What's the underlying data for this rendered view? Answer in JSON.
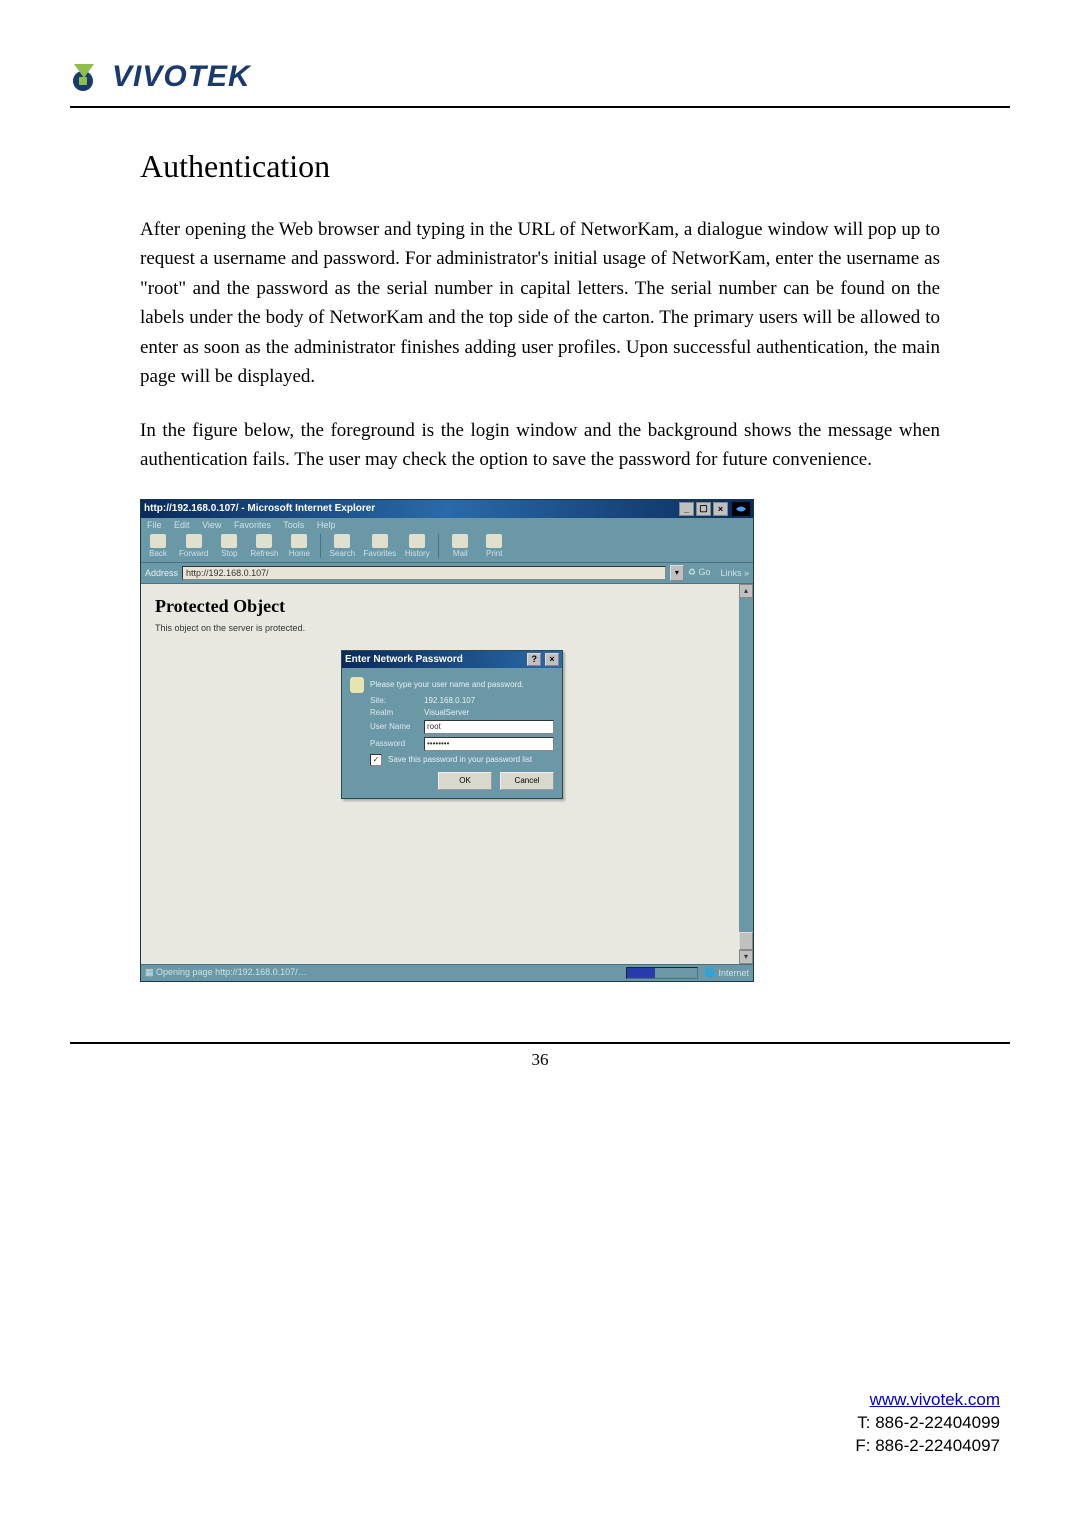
{
  "brand": {
    "name": "VIVOTEK"
  },
  "section": {
    "title": "Authentication",
    "para1": "After opening the Web browser and typing in the URL of NetworKam, a dialogue window will pop up to request a username and password. For administrator's initial usage of NetworKam, enter the username as \"root\" and the password as the serial number in capital letters. The serial number can be found on the labels under the body of NetworKam and the top side of the carton. The primary users will be allowed to enter as soon as the administrator finishes adding user profiles. Upon successful authentication, the main page will be displayed.",
    "para2": "In the figure below, the foreground is the login window and the background shows the message when authentication fails. The user may check the option to save the password for future convenience."
  },
  "ie": {
    "title": "http://192.168.0.107/ - Microsoft Internet Explorer",
    "menus": [
      "File",
      "Edit",
      "View",
      "Favorites",
      "Tools",
      "Help"
    ],
    "toolbar": [
      "Back",
      "Forward",
      "Stop",
      "Refresh",
      "Home",
      "Search",
      "Favorites",
      "History",
      "Mail",
      "Print"
    ],
    "address_label": "Address",
    "address_value": "http://192.168.0.107/",
    "go_label": "Go",
    "links_label": "Links »",
    "page": {
      "heading": "Protected Object",
      "text": "This object on the server is protected."
    },
    "status": {
      "text": "Opening page http://192.168.0.107/…",
      "zone": "Internet"
    }
  },
  "dialog": {
    "title": "Enter Network Password",
    "prompt": "Please type your user name and password.",
    "site_label": "Site:",
    "site_value": "192.168.0.107",
    "realm_label": "Realm",
    "realm_value": "VisualServer",
    "user_label": "User Name",
    "user_value": "root",
    "pass_label": "Password",
    "pass_value": "********",
    "save_label": "Save this password in your password list",
    "ok": "OK",
    "cancel": "Cancel"
  },
  "footer": {
    "page_number": "36",
    "url": "www.vivotek.com",
    "tel_label": "T: 886-2-22404099",
    "fax_label": "F: 886-2-22404097"
  }
}
